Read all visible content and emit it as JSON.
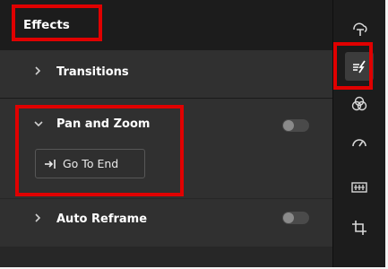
{
  "panel": {
    "title": "Effects",
    "sections": {
      "transitions": {
        "label": "Transitions",
        "expanded": false
      },
      "pan_and_zoom": {
        "label": "Pan and Zoom",
        "expanded": true,
        "enabled": false,
        "go_to_end_label": "Go To End"
      },
      "auto_reframe": {
        "label": "Auto Reframe",
        "expanded": false,
        "enabled": false
      }
    }
  },
  "sidebar": {
    "items": [
      {
        "icon": "text-tool-icon",
        "active": false
      },
      {
        "icon": "effects-icon",
        "active": true
      },
      {
        "icon": "color-circles-icon",
        "active": false
      },
      {
        "icon": "speed-gauge-icon",
        "active": false
      },
      {
        "icon": "stretch-frame-icon",
        "active": false
      },
      {
        "icon": "crop-icon",
        "active": false
      }
    ]
  },
  "colors": {
    "highlight": "#e00000",
    "panel_bg": "#303030",
    "header_bg": "#1c1c1c"
  }
}
